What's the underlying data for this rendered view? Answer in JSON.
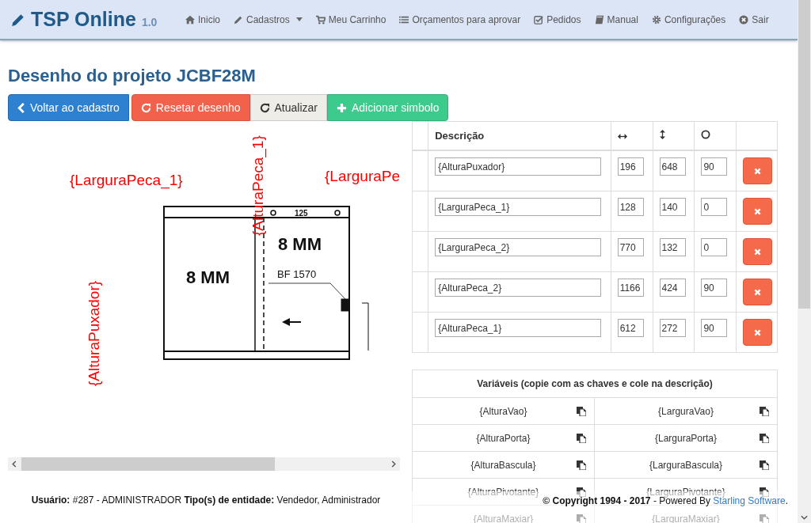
{
  "navbar": {
    "brand": "TSP Online",
    "version": "1.0",
    "items": [
      {
        "label": "Inicio",
        "dropdown": false
      },
      {
        "label": "Cadastros",
        "dropdown": true
      },
      {
        "label": "Meu Carrinho",
        "dropdown": false
      },
      {
        "label": "Orçamentos para aprovar",
        "dropdown": false
      },
      {
        "label": "Pedidos",
        "dropdown": false
      },
      {
        "label": "Manual",
        "dropdown": false
      },
      {
        "label": "Configurações",
        "dropdown": false
      },
      {
        "label": "Sair",
        "dropdown": false
      }
    ]
  },
  "title": "Desenho do projeto JCBF28M",
  "buttons": [
    {
      "label": "Voltar ao cadastro",
      "kind": "primary"
    },
    {
      "label": "Resetar desenho",
      "kind": "danger"
    },
    {
      "label": "Atualizar",
      "kind": "default"
    },
    {
      "label": "Adicionar simbolo",
      "kind": "success"
    }
  ],
  "drawing": {
    "labels": [
      "125",
      "8 MM",
      "8 MM",
      "BF 1570"
    ],
    "overlay_labels": [
      {
        "text": "{LarguraPeca_1}",
        "kind": "horizontal"
      },
      {
        "text": "{AlturaPeca_1}",
        "kind": "vertical"
      },
      {
        "text": "{LarguraPe",
        "kind": "horizontal"
      },
      {
        "text": "{AlturaPuxador}",
        "kind": "vertical"
      }
    ]
  },
  "symbols": {
    "columns": [
      "Descrição"
    ],
    "rows": [
      {
        "description": "{AlturaPuxador}",
        "values": [
          "196",
          "648",
          "90"
        ]
      },
      {
        "description": "{LarguraPeca_1}",
        "values": [
          "128",
          "140",
          "0"
        ]
      },
      {
        "description": "{LarguraPeca_2}",
        "values": [
          "770",
          "132",
          "0"
        ]
      },
      {
        "description": "{AlturaPeca_2}",
        "values": [
          "1166",
          "424",
          "90"
        ]
      },
      {
        "description": "{AlturaPeca_1}",
        "values": [
          "612",
          "272",
          "90"
        ]
      }
    ]
  },
  "variables": {
    "title": "Variáveis (copie com as chaves e cole na descrição)",
    "items": [
      "{AlturaVao}",
      "{LarguraVao}",
      "{AlturaPorta}",
      "{LarguraPorta}",
      "{AlturaBascula}",
      "{LarguraBascula}",
      "{AlturaPivotante}",
      "{LarguraPivotante}",
      "{AlturaMaxiar}",
      "{LarguraMaxiar}"
    ]
  },
  "footer": {
    "user": "**Usuário:** #287 - ADMINISTRADOR **Tipo(s) de entidade:** Vendedor, Administrador",
    "copyright": "**© Copyright 1994 - 2017** - Powered By",
    "link": "Starling Software",
    "end": "."
  }
}
